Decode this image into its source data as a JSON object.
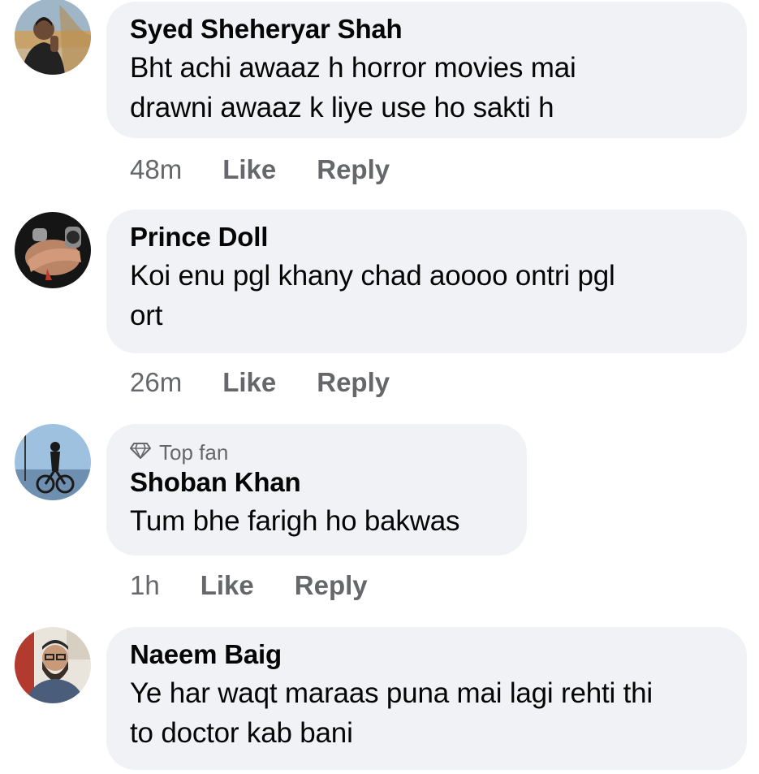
{
  "comments": [
    {
      "author": "Syed Sheheryar Shah",
      "text_lines": [
        "Bht achi awaaz h horror movies mai",
        "drawni awaaz k liye use ho sakti h"
      ],
      "time": "48m",
      "like": "Like",
      "reply": "Reply",
      "avatar_icon": "profile-photo"
    },
    {
      "author": "Prince Doll",
      "text_lines": [
        "Koi enu pgl khany chad aoooo ontri pgl",
        "ort"
      ],
      "time": "26m",
      "like": "Like",
      "reply": "Reply",
      "avatar_icon": "profile-photo"
    },
    {
      "badge": "Top fan",
      "badge_icon": "diamond-icon",
      "author": "Shoban Khan",
      "text_lines": [
        "Tum bhe farigh ho bakwas"
      ],
      "time": "1h",
      "like": "Like",
      "reply": "Reply",
      "avatar_icon": "profile-photo"
    },
    {
      "author": "Naeem Baig",
      "text_lines": [
        "Ye har waqt maraas puna mai lagi rehti thi",
        "to doctor kab bani"
      ],
      "avatar_icon": "profile-photo"
    }
  ],
  "colors": {
    "bubble": "#f0f2f5",
    "author": "#050505",
    "meta": "#65676b"
  }
}
